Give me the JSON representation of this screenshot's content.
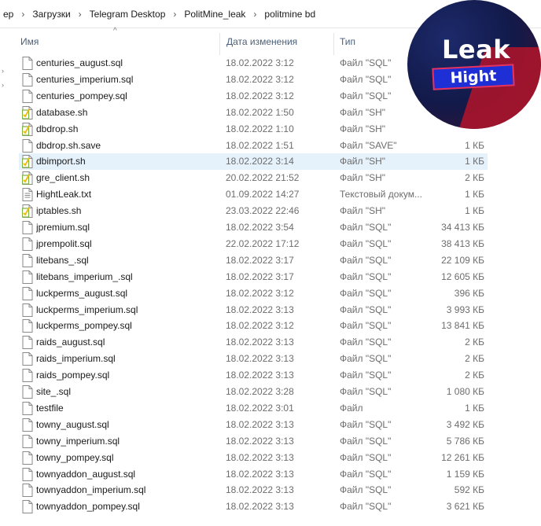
{
  "breadcrumb": [
    "ер",
    "Загрузки",
    "Telegram Desktop",
    "PolitMine_leak",
    "politmine bd"
  ],
  "columns": {
    "name": "Имя",
    "date": "Дата изменения",
    "type": "Тип"
  },
  "logo": {
    "line1": "Leak",
    "line2": "Hight"
  },
  "colors": {
    "selected_row": "#e5f1fb",
    "header_text": "#4c607a",
    "script_icon": "#7cb342"
  },
  "files": [
    {
      "name": "centuries_august.sql",
      "date": "18.02.2022 3:12",
      "type": "Файл \"SQL\"",
      "size": "",
      "icon": "document-icon"
    },
    {
      "name": "centuries_imperium.sql",
      "date": "18.02.2022 3:12",
      "type": "Файл \"SQL\"",
      "size": "5",
      "icon": "document-icon"
    },
    {
      "name": "centuries_pompey.sql",
      "date": "18.02.2022 3:12",
      "type": "Файл \"SQL\"",
      "size": "",
      "icon": "document-icon"
    },
    {
      "name": "database.sh",
      "date": "18.02.2022 1:50",
      "type": "Файл \"SH\"",
      "size": "",
      "icon": "script-icon"
    },
    {
      "name": "dbdrop.sh",
      "date": "18.02.2022 1:10",
      "type": "Файл \"SH\"",
      "size": "",
      "icon": "script-icon"
    },
    {
      "name": "dbdrop.sh.save",
      "date": "18.02.2022 1:51",
      "type": "Файл \"SAVE\"",
      "size": "1 КБ",
      "icon": "document-icon"
    },
    {
      "name": "dbimport.sh",
      "date": "18.02.2022 3:14",
      "type": "Файл \"SH\"",
      "size": "1 КБ",
      "icon": "script-icon",
      "selected": true
    },
    {
      "name": "gre_client.sh",
      "date": "20.02.2022 21:52",
      "type": "Файл \"SH\"",
      "size": "2 КБ",
      "icon": "script-icon"
    },
    {
      "name": "HightLeak.txt",
      "date": "01.09.2022 14:27",
      "type": "Текстовый докум...",
      "size": "1 КБ",
      "icon": "text-file-icon"
    },
    {
      "name": "iptables.sh",
      "date": "23.03.2022 22:46",
      "type": "Файл \"SH\"",
      "size": "1 КБ",
      "icon": "script-icon"
    },
    {
      "name": "jpremium.sql",
      "date": "18.02.2022 3:54",
      "type": "Файл \"SQL\"",
      "size": "34 413 КБ",
      "icon": "document-icon"
    },
    {
      "name": "jprempolit.sql",
      "date": "22.02.2022 17:12",
      "type": "Файл \"SQL\"",
      "size": "38 413 КБ",
      "icon": "document-icon"
    },
    {
      "name": "litebans_.sql",
      "date": "18.02.2022 3:17",
      "type": "Файл \"SQL\"",
      "size": "22 109 КБ",
      "icon": "document-icon"
    },
    {
      "name": "litebans_imperium_.sql",
      "date": "18.02.2022 3:17",
      "type": "Файл \"SQL\"",
      "size": "12 605 КБ",
      "icon": "document-icon"
    },
    {
      "name": "luckperms_august.sql",
      "date": "18.02.2022 3:12",
      "type": "Файл \"SQL\"",
      "size": "396 КБ",
      "icon": "document-icon"
    },
    {
      "name": "luckperms_imperium.sql",
      "date": "18.02.2022 3:13",
      "type": "Файл \"SQL\"",
      "size": "3 993 КБ",
      "icon": "document-icon"
    },
    {
      "name": "luckperms_pompey.sql",
      "date": "18.02.2022 3:12",
      "type": "Файл \"SQL\"",
      "size": "13 841 КБ",
      "icon": "document-icon"
    },
    {
      "name": "raids_august.sql",
      "date": "18.02.2022 3:13",
      "type": "Файл \"SQL\"",
      "size": "2 КБ",
      "icon": "document-icon"
    },
    {
      "name": "raids_imperium.sql",
      "date": "18.02.2022 3:13",
      "type": "Файл \"SQL\"",
      "size": "2 КБ",
      "icon": "document-icon"
    },
    {
      "name": "raids_pompey.sql",
      "date": "18.02.2022 3:13",
      "type": "Файл \"SQL\"",
      "size": "2 КБ",
      "icon": "document-icon"
    },
    {
      "name": "site_.sql",
      "date": "18.02.2022 3:28",
      "type": "Файл \"SQL\"",
      "size": "1 080 КБ",
      "icon": "document-icon"
    },
    {
      "name": "testfile",
      "date": "18.02.2022 3:01",
      "type": "Файл",
      "size": "1 КБ",
      "icon": "document-icon"
    },
    {
      "name": "towny_august.sql",
      "date": "18.02.2022 3:13",
      "type": "Файл \"SQL\"",
      "size": "3 492 КБ",
      "icon": "document-icon"
    },
    {
      "name": "towny_imperium.sql",
      "date": "18.02.2022 3:13",
      "type": "Файл \"SQL\"",
      "size": "5 786 КБ",
      "icon": "document-icon"
    },
    {
      "name": "towny_pompey.sql",
      "date": "18.02.2022 3:13",
      "type": "Файл \"SQL\"",
      "size": "12 261 КБ",
      "icon": "document-icon"
    },
    {
      "name": "townyaddon_august.sql",
      "date": "18.02.2022 3:13",
      "type": "Файл \"SQL\"",
      "size": "1 159 КБ",
      "icon": "document-icon"
    },
    {
      "name": "townyaddon_imperium.sql",
      "date": "18.02.2022 3:13",
      "type": "Файл \"SQL\"",
      "size": "592 КБ",
      "icon": "document-icon"
    },
    {
      "name": "townyaddon_pompey.sql",
      "date": "18.02.2022 3:13",
      "type": "Файл \"SQL\"",
      "size": "3 621 КБ",
      "icon": "document-icon"
    }
  ]
}
